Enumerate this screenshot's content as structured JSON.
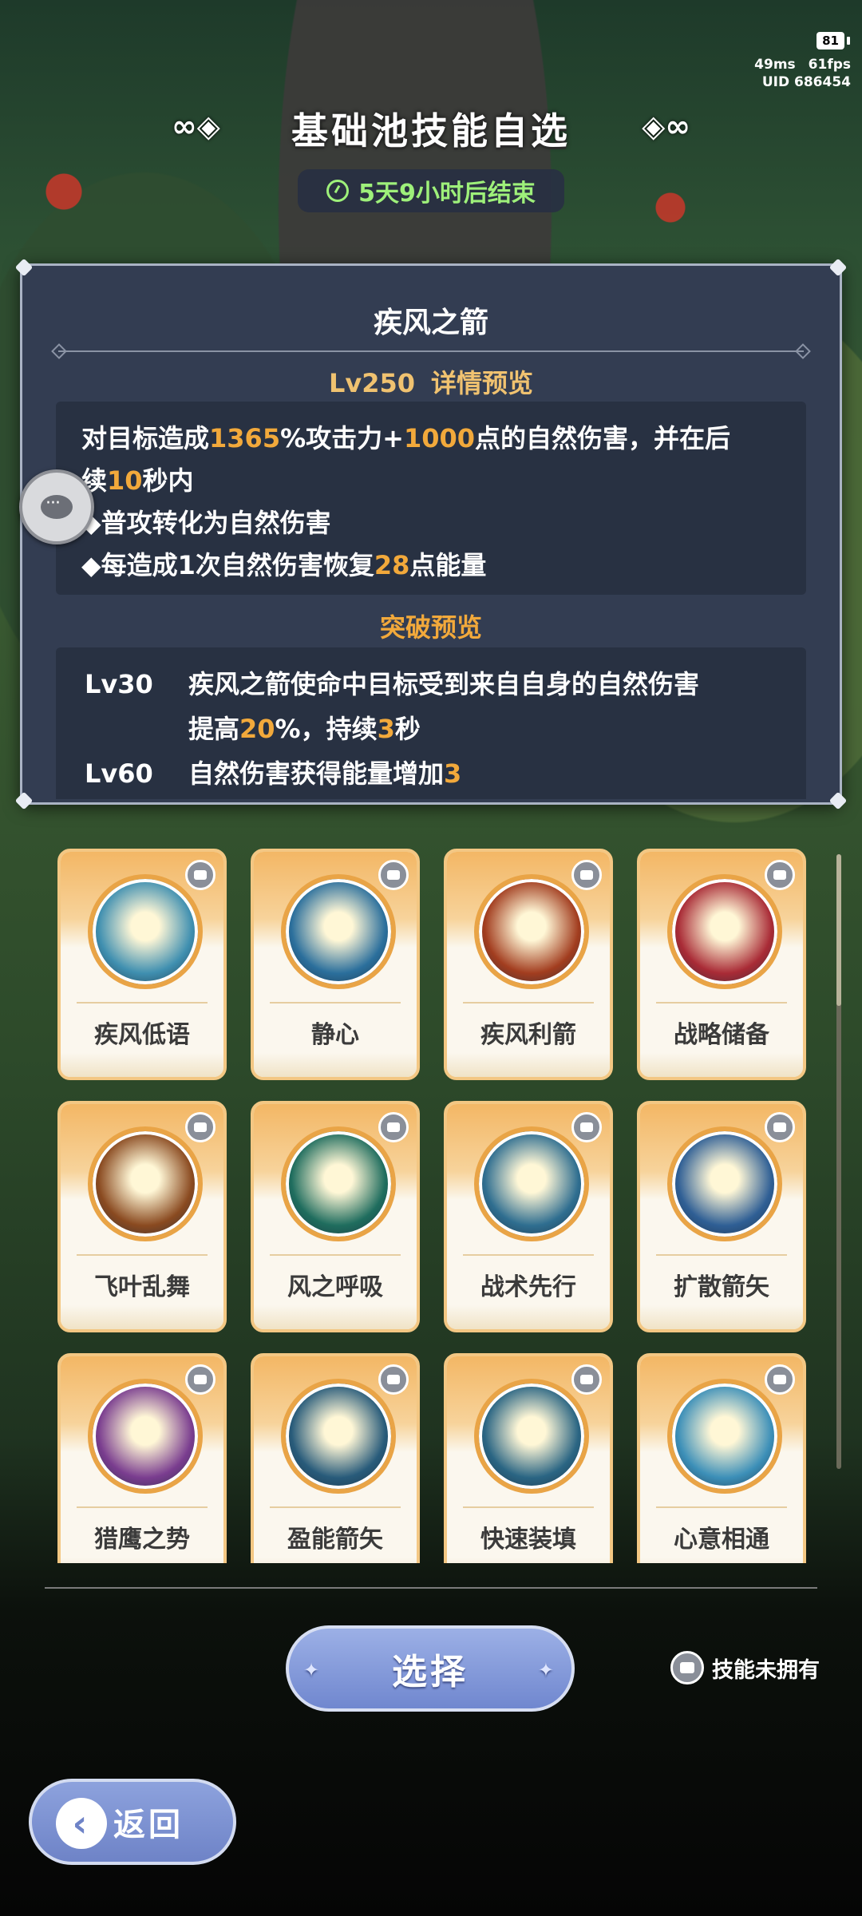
{
  "status": {
    "battery": "81",
    "ping": "49ms",
    "fps": "61fps",
    "uid": "UID 686454"
  },
  "header": {
    "title": "基础池技能自选",
    "timer": "5天9小时后结束"
  },
  "detail": {
    "name": "疾风之箭",
    "level": "Lv250",
    "preview_label": "详情预览",
    "desc_lines": [
      [
        {
          "t": "对目标造成"
        },
        {
          "t": "1365",
          "h": true
        },
        {
          "t": "%攻击力+"
        },
        {
          "t": "1000",
          "h": true
        },
        {
          "t": "点的自然伤害，并在后"
        }
      ],
      [
        {
          "t": "续"
        },
        {
          "t": "10",
          "h": true
        },
        {
          "t": "秒内"
        }
      ],
      [
        {
          "t": "◆普攻转化为自然伤害"
        }
      ],
      [
        {
          "t": "◆每造成1次自然伤害恢复"
        },
        {
          "t": "28",
          "h": true
        },
        {
          "t": "点能量"
        }
      ]
    ],
    "break_label": "突破预览",
    "breakthroughs": [
      {
        "lv": "Lv30",
        "lines": [
          [
            {
              "t": "疾风之箭使命中目标受到来自自身的自然伤害"
            }
          ],
          [
            {
              "t": "提高"
            },
            {
              "t": "20",
              "h": true
            },
            {
              "t": "%，持续"
            },
            {
              "t": "3",
              "h": true
            },
            {
              "t": "秒"
            }
          ]
        ]
      },
      {
        "lv": "Lv60",
        "lines": [
          [
            {
              "t": "自然伤害获得能量增加"
            },
            {
              "t": "3",
              "h": true
            }
          ]
        ]
      }
    ]
  },
  "skills": [
    {
      "name": "疾风低语",
      "icon": "wind-arrows-icon",
      "color": "#3f8fb0"
    },
    {
      "name": "静心",
      "icon": "heart-icon",
      "color": "#2b6f9c"
    },
    {
      "name": "疾风利箭",
      "icon": "burst-arrow-icon",
      "color": "#a23d1f"
    },
    {
      "name": "战略储备",
      "icon": "red-lightning-icon",
      "color": "#a92b36"
    },
    {
      "name": "飞叶乱舞",
      "icon": "leaf-swirl-icon",
      "color": "#8a4a20"
    },
    {
      "name": "风之呼吸",
      "icon": "green-cross-icon",
      "color": "#1f6d5e"
    },
    {
      "name": "战术先行",
      "icon": "hand-icon",
      "color": "#2f6e90"
    },
    {
      "name": "扩散箭矢",
      "icon": "spread-arrows-icon",
      "color": "#2f5f95"
    },
    {
      "name": "猎鹰之势",
      "icon": "crosshair-icon",
      "color": "#7a3d8f"
    },
    {
      "name": "盈能箭矢",
      "icon": "charged-arrow-icon",
      "color": "#285b7a"
    },
    {
      "name": "快速装填",
      "icon": "quiver-icon",
      "color": "#2a6583"
    },
    {
      "name": "心意相通",
      "icon": "wolf-icon",
      "color": "#3c8fb8"
    }
  ],
  "footer": {
    "select_label": "选择",
    "legend_label": "技能未拥有",
    "back_label": "返回"
  }
}
